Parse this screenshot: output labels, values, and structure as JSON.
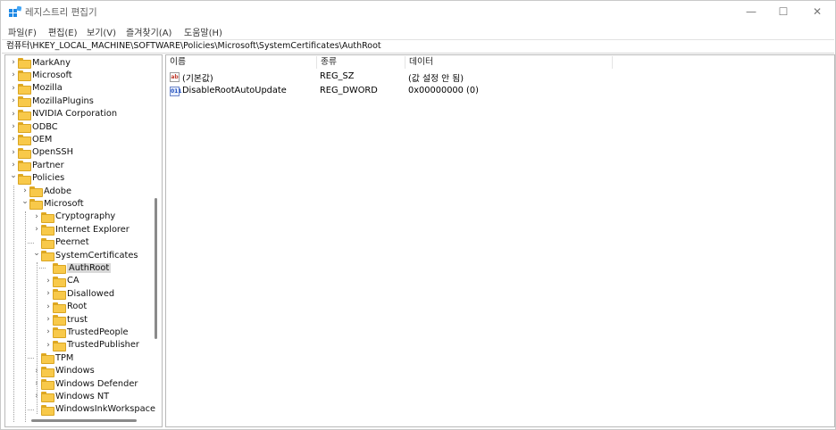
{
  "window": {
    "title": "레지스트리 편집기",
    "controls": {
      "minimize": "—",
      "maximize": "☐",
      "close": "✕"
    }
  },
  "menu": [
    "파일(F)",
    "편집(E)",
    "보기(V)",
    "즐겨찾기(A)",
    "도움말(H)"
  ],
  "address": "컴퓨터\\HKEY_LOCAL_MACHINE\\SOFTWARE\\Policies\\Microsoft\\SystemCertificates\\AuthRoot",
  "tree": [
    {
      "label": "MarkAny",
      "depth": 0,
      "expander": "collapsed"
    },
    {
      "label": "Microsoft",
      "depth": 0,
      "expander": "collapsed"
    },
    {
      "label": "Mozilla",
      "depth": 0,
      "expander": "collapsed"
    },
    {
      "label": "MozillaPlugins",
      "depth": 0,
      "expander": "collapsed"
    },
    {
      "label": "NVIDIA Corporation",
      "depth": 0,
      "expander": "collapsed"
    },
    {
      "label": "ODBC",
      "depth": 0,
      "expander": "collapsed"
    },
    {
      "label": "OEM",
      "depth": 0,
      "expander": "collapsed"
    },
    {
      "label": "OpenSSH",
      "depth": 0,
      "expander": "collapsed"
    },
    {
      "label": "Partner",
      "depth": 0,
      "expander": "collapsed"
    },
    {
      "label": "Policies",
      "depth": 0,
      "expander": "expanded"
    },
    {
      "label": "Adobe",
      "depth": 1,
      "expander": "collapsed"
    },
    {
      "label": "Microsoft",
      "depth": 1,
      "expander": "expanded"
    },
    {
      "label": "Cryptography",
      "depth": 2,
      "expander": "collapsed"
    },
    {
      "label": "Internet Explorer",
      "depth": 2,
      "expander": "collapsed"
    },
    {
      "label": "Peernet",
      "depth": 2,
      "expander": "none"
    },
    {
      "label": "SystemCertificates",
      "depth": 2,
      "expander": "expanded"
    },
    {
      "label": "AuthRoot",
      "depth": 3,
      "expander": "none",
      "selected": true
    },
    {
      "label": "CA",
      "depth": 3,
      "expander": "collapsed"
    },
    {
      "label": "Disallowed",
      "depth": 3,
      "expander": "collapsed"
    },
    {
      "label": "Root",
      "depth": 3,
      "expander": "collapsed"
    },
    {
      "label": "trust",
      "depth": 3,
      "expander": "collapsed"
    },
    {
      "label": "TrustedPeople",
      "depth": 3,
      "expander": "collapsed"
    },
    {
      "label": "TrustedPublisher",
      "depth": 3,
      "expander": "collapsed"
    },
    {
      "label": "TPM",
      "depth": 2,
      "expander": "none"
    },
    {
      "label": "Windows",
      "depth": 2,
      "expander": "collapsed"
    },
    {
      "label": "Windows Defender",
      "depth": 2,
      "expander": "collapsed"
    },
    {
      "label": "Windows NT",
      "depth": 2,
      "expander": "collapsed"
    },
    {
      "label": "WindowsInkWorkspace",
      "depth": 2,
      "expander": "none"
    }
  ],
  "columns": [
    "이름",
    "종류",
    "데이터"
  ],
  "values": [
    {
      "icon": "string-value-icon",
      "icon_text": "ab",
      "name": "(기본값)",
      "type": "REG_SZ",
      "data": "(값 설정 안 됨)"
    },
    {
      "icon": "dword-value-icon",
      "icon_text": "011",
      "name": "DisableRootAutoUpdate",
      "type": "REG_DWORD",
      "data": "0x00000000 (0)"
    }
  ],
  "colors": {
    "folder": "#f8c94a",
    "selection": "#d9d9d9",
    "app_icon": "#1e88e5"
  }
}
